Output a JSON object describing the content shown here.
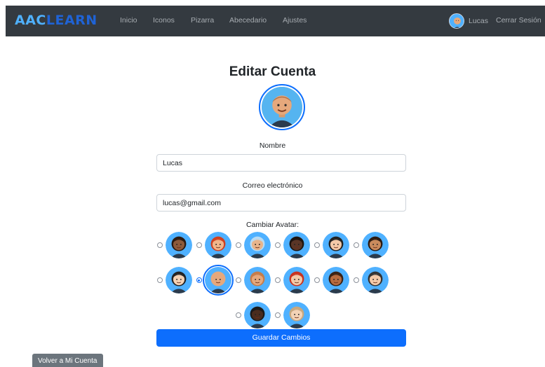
{
  "nav": {
    "brand_part1": "AAC",
    "brand_part2": "LEARN",
    "links": [
      "Inicio",
      "Iconos",
      "Pizarra",
      "Abecedario",
      "Ajustes"
    ],
    "user_name": "Lucas",
    "logout": "Cerrar Sesión"
  },
  "form": {
    "title": "Editar Cuenta",
    "name_label": "Nombre",
    "name_value": "Lucas",
    "email_label": "Correo electrónico",
    "email_value": "lucas@gmail.com",
    "avatar_label": "Cambiar Avatar:",
    "submit": "Guardar Cambios"
  },
  "back_button": "Volver a Mi Cuenta",
  "avatar_rows": [
    [
      {
        "name": "avatar-woman-curly-dark",
        "bg": "#4fb1ff",
        "skin": "#8d5a3b",
        "hair": "#2a1a12",
        "selected": false
      },
      {
        "name": "avatar-woman-red-hair",
        "bg": "#4fb1ff",
        "skin": "#f1b58a",
        "hair": "#d0401f",
        "selected": false
      },
      {
        "name": "avatar-woman-hijab",
        "bg": "#4fb1ff",
        "skin": "#e8b48b",
        "hair": "#b9dbf3",
        "selected": false
      },
      {
        "name": "avatar-woman-dark-curly",
        "bg": "#4fb1ff",
        "skin": "#5a3526",
        "hair": "#1d1410",
        "selected": false
      },
      {
        "name": "avatar-woman-glasses",
        "bg": "#4fb1ff",
        "skin": "#f3c9a8",
        "hair": "#222222",
        "selected": false
      },
      {
        "name": "avatar-woman-brown-glasses",
        "bg": "#4fb1ff",
        "skin": "#c98a5d",
        "hair": "#2a1a12",
        "selected": false
      }
    ],
    [
      {
        "name": "avatar-man-black-hair",
        "bg": "#4fb1ff",
        "skin": "#f5d2b3",
        "hair": "#222222",
        "selected": false
      },
      {
        "name": "avatar-man-bald",
        "bg": "#4fb1ff",
        "skin": "#e6a87c",
        "hair": "#e6a87c",
        "selected": true
      },
      {
        "name": "avatar-man-short-hair",
        "bg": "#4fb1ff",
        "skin": "#e6a87c",
        "hair": "#c57c4a",
        "selected": false
      },
      {
        "name": "avatar-woman-red-glasses",
        "bg": "#4fb1ff",
        "skin": "#f3c9a8",
        "hair": "#c8321f",
        "selected": false
      },
      {
        "name": "avatar-man-curly-open-mouth",
        "bg": "#4fb1ff",
        "skin": "#b86b3e",
        "hair": "#3a2214",
        "selected": false
      },
      {
        "name": "avatar-man-dark-hair",
        "bg": "#4fb1ff",
        "skin": "#f3c9a8",
        "hair": "#333333",
        "selected": false
      }
    ],
    [
      {
        "name": "avatar-man-dark-skin",
        "bg": "#4fb1ff",
        "skin": "#4a2c1e",
        "hair": "#1a1a1a",
        "selected": false
      },
      {
        "name": "avatar-woman-blonde",
        "bg": "#4fb1ff",
        "skin": "#f3d2b6",
        "hair": "#c8a77e",
        "selected": false
      }
    ]
  ],
  "colors": {
    "primary": "#0d6efd",
    "navbar": "#343a40",
    "secondary": "#6c757d",
    "brand_light": "#4fb1ff",
    "brand_dark": "#1f63d6"
  }
}
